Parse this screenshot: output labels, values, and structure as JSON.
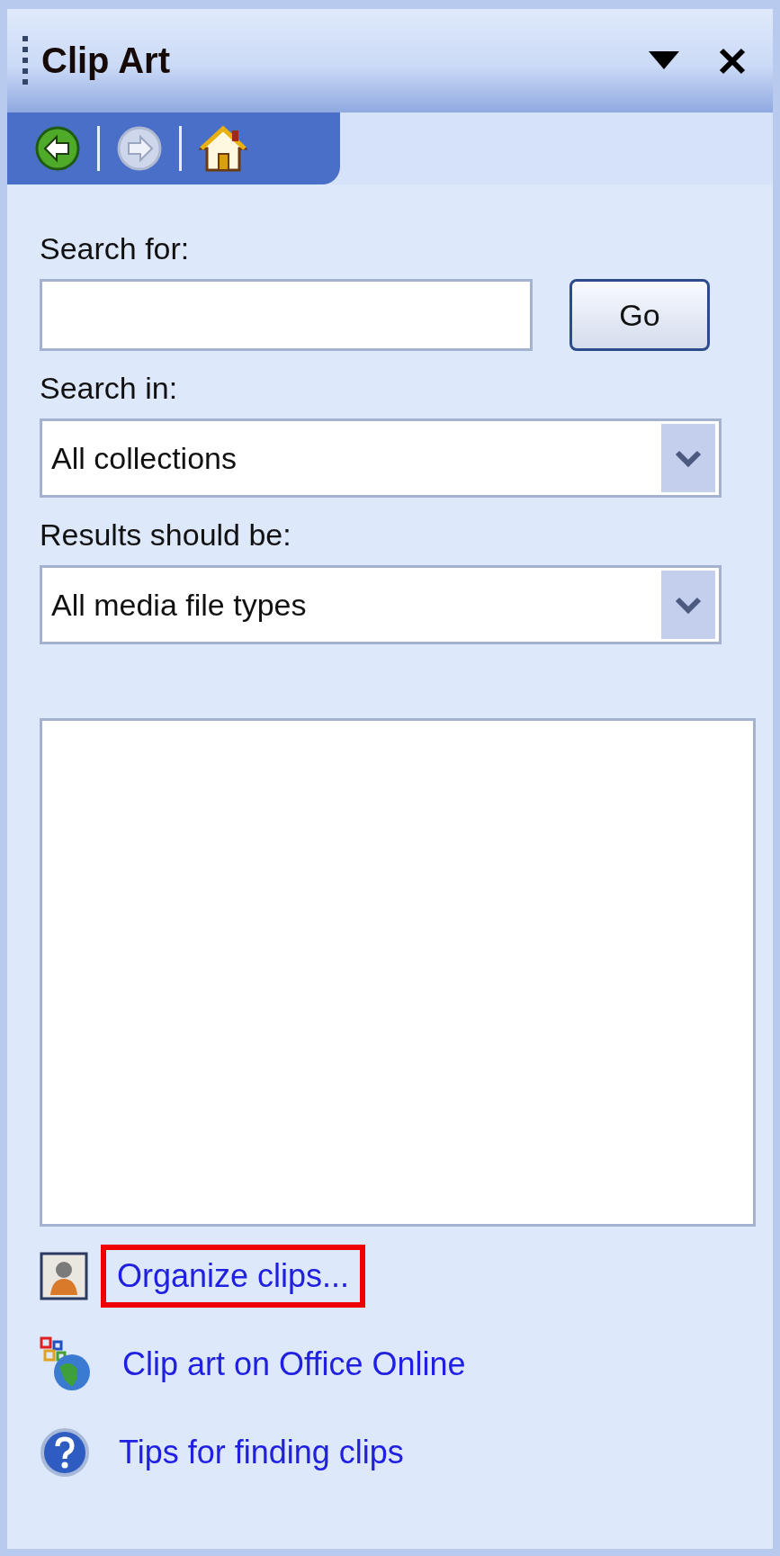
{
  "pane": {
    "title": "Clip Art"
  },
  "nav": [
    {
      "kind": "back",
      "disabled": false
    },
    {
      "kind": "forward",
      "disabled": true
    },
    {
      "kind": "home",
      "disabled": false
    }
  ],
  "search_for": {
    "label": "Search for:",
    "button": "Go"
  },
  "search_in": {
    "label": "Search in:",
    "value": "All collections"
  },
  "results_should_be": {
    "label": "Results should be:",
    "value": "All media file types"
  },
  "links": [
    {
      "kind": "organize",
      "text": "Organize clips...",
      "highlighted": true
    },
    {
      "kind": "online",
      "text": "Clip art on Office Online",
      "highlighted": false
    },
    {
      "kind": "tips",
      "text": "Tips for finding clips",
      "highlighted": false
    }
  ]
}
